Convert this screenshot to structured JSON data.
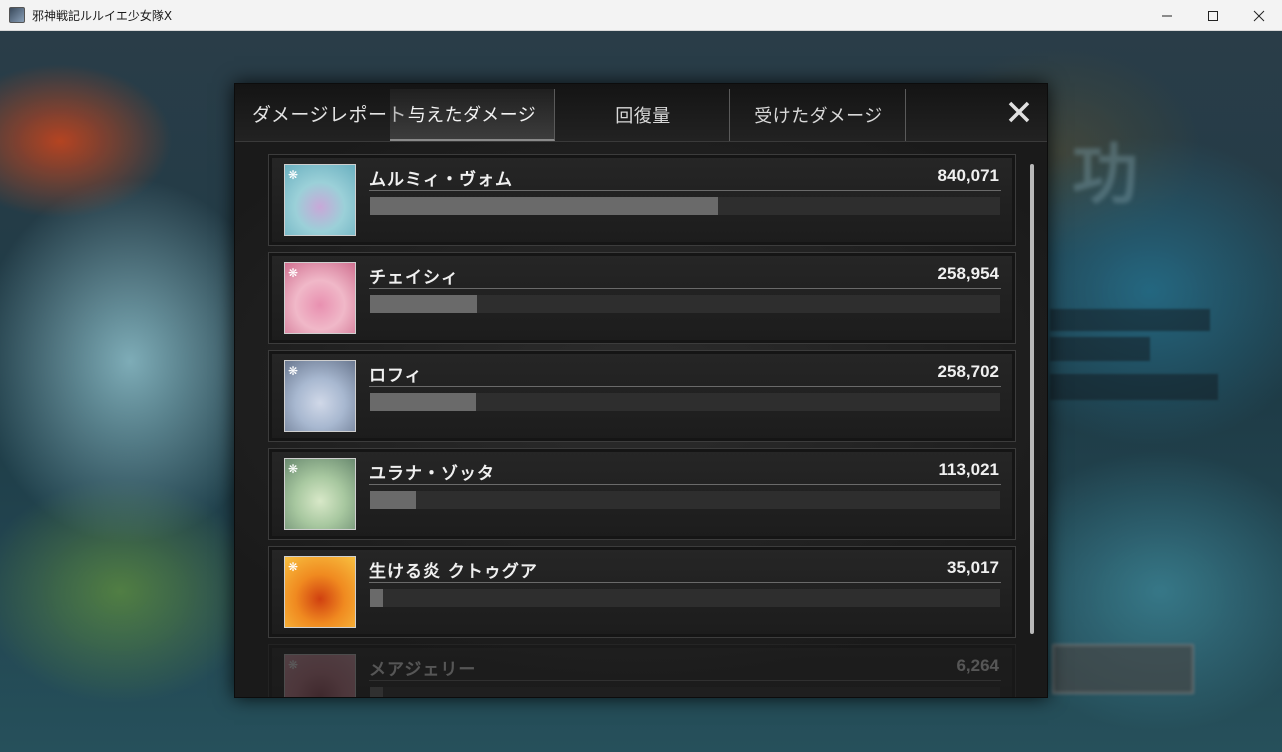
{
  "window": {
    "title": "邪神戦記ルルイエ少女隊X"
  },
  "dialog": {
    "report_title": "ダメージレポート",
    "tabs": [
      {
        "label": "与えたダメージ",
        "active": true
      },
      {
        "label": "回復量",
        "active": false
      },
      {
        "label": "受けたダメージ",
        "active": false
      }
    ]
  },
  "entries": [
    {
      "name": "ムルミィ・ヴォム",
      "damage": "840,071",
      "fill": 0.553,
      "colors": [
        "#9bd0d8",
        "#c8a8d8",
        "#6ab0c0"
      ]
    },
    {
      "name": "チェイシィ",
      "damage": "258,954",
      "fill": 0.17,
      "colors": [
        "#f0b8c8",
        "#e890b0",
        "#d07090"
      ]
    },
    {
      "name": "ロフィ",
      "damage": "258,702",
      "fill": 0.168,
      "colors": [
        "#a8b8d0",
        "#d0d8e8",
        "#6a7890"
      ]
    },
    {
      "name": "ユラナ・ゾッタ",
      "damage": "113,021",
      "fill": 0.073,
      "colors": [
        "#a8c8a0",
        "#d8e8c8",
        "#6a8a70"
      ]
    },
    {
      "name": "生ける炎  クトゥグア",
      "damage": "35,017",
      "fill": 0.02,
      "colors": [
        "#f08a20",
        "#d04010",
        "#f8c040"
      ]
    },
    {
      "name": "メアジェリー",
      "damage": "6,264",
      "fill": 0.004,
      "colors": [
        "#d08090",
        "#a05060",
        "#e0a0b0"
      ]
    }
  ],
  "accent": "#6a6a6a"
}
